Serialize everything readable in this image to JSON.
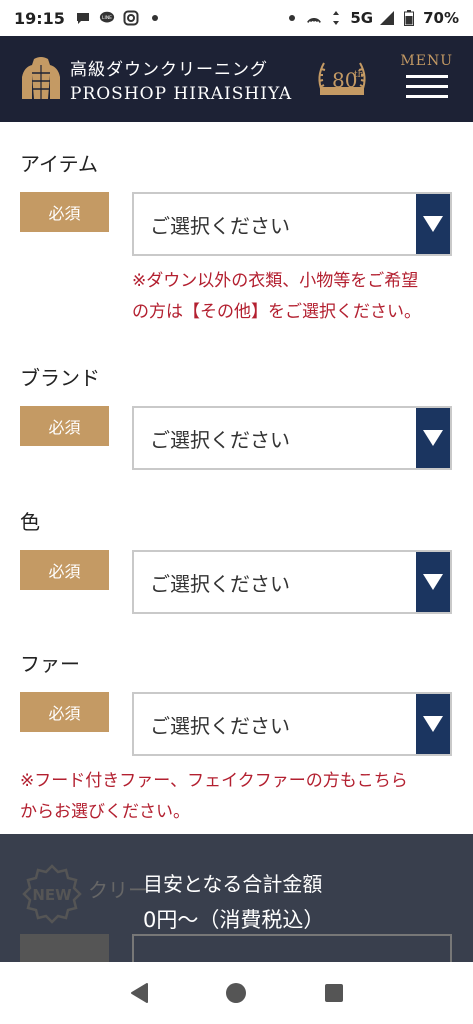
{
  "status_bar": {
    "time": "19:15",
    "network": "5G",
    "battery": "70%"
  },
  "header": {
    "brand_ja": "高級ダウンクリーニング",
    "brand_en": "PROSHOP HIRAISHIYA",
    "anniversary_number": "80",
    "anniversary_suffix": "th",
    "menu_label": "MENU"
  },
  "form": {
    "item": {
      "label": "アイテム",
      "required": "必須",
      "select_value": "ご選択ください",
      "note_line1": "※ダウン以外の衣類、小物等をご希望",
      "note_line2": "の方は【その他】をご選択ください。"
    },
    "brand": {
      "label": "ブランド",
      "required": "必須",
      "select_value": "ご選択ください"
    },
    "color": {
      "label": "色",
      "required": "必須",
      "select_value": "ご選択ください"
    },
    "fur": {
      "label": "ファー",
      "required": "必須",
      "select_value": "ご選択ください",
      "note_line1": "※フード付きファー、フェイクファーの方もこちら",
      "note_line2": "からお選びください。"
    },
    "cleaning_peek": {
      "label": "クリー",
      "badge": "NEW"
    }
  },
  "total": {
    "title": "目安となる合計金額",
    "value": "0円〜（消費税込）"
  }
}
